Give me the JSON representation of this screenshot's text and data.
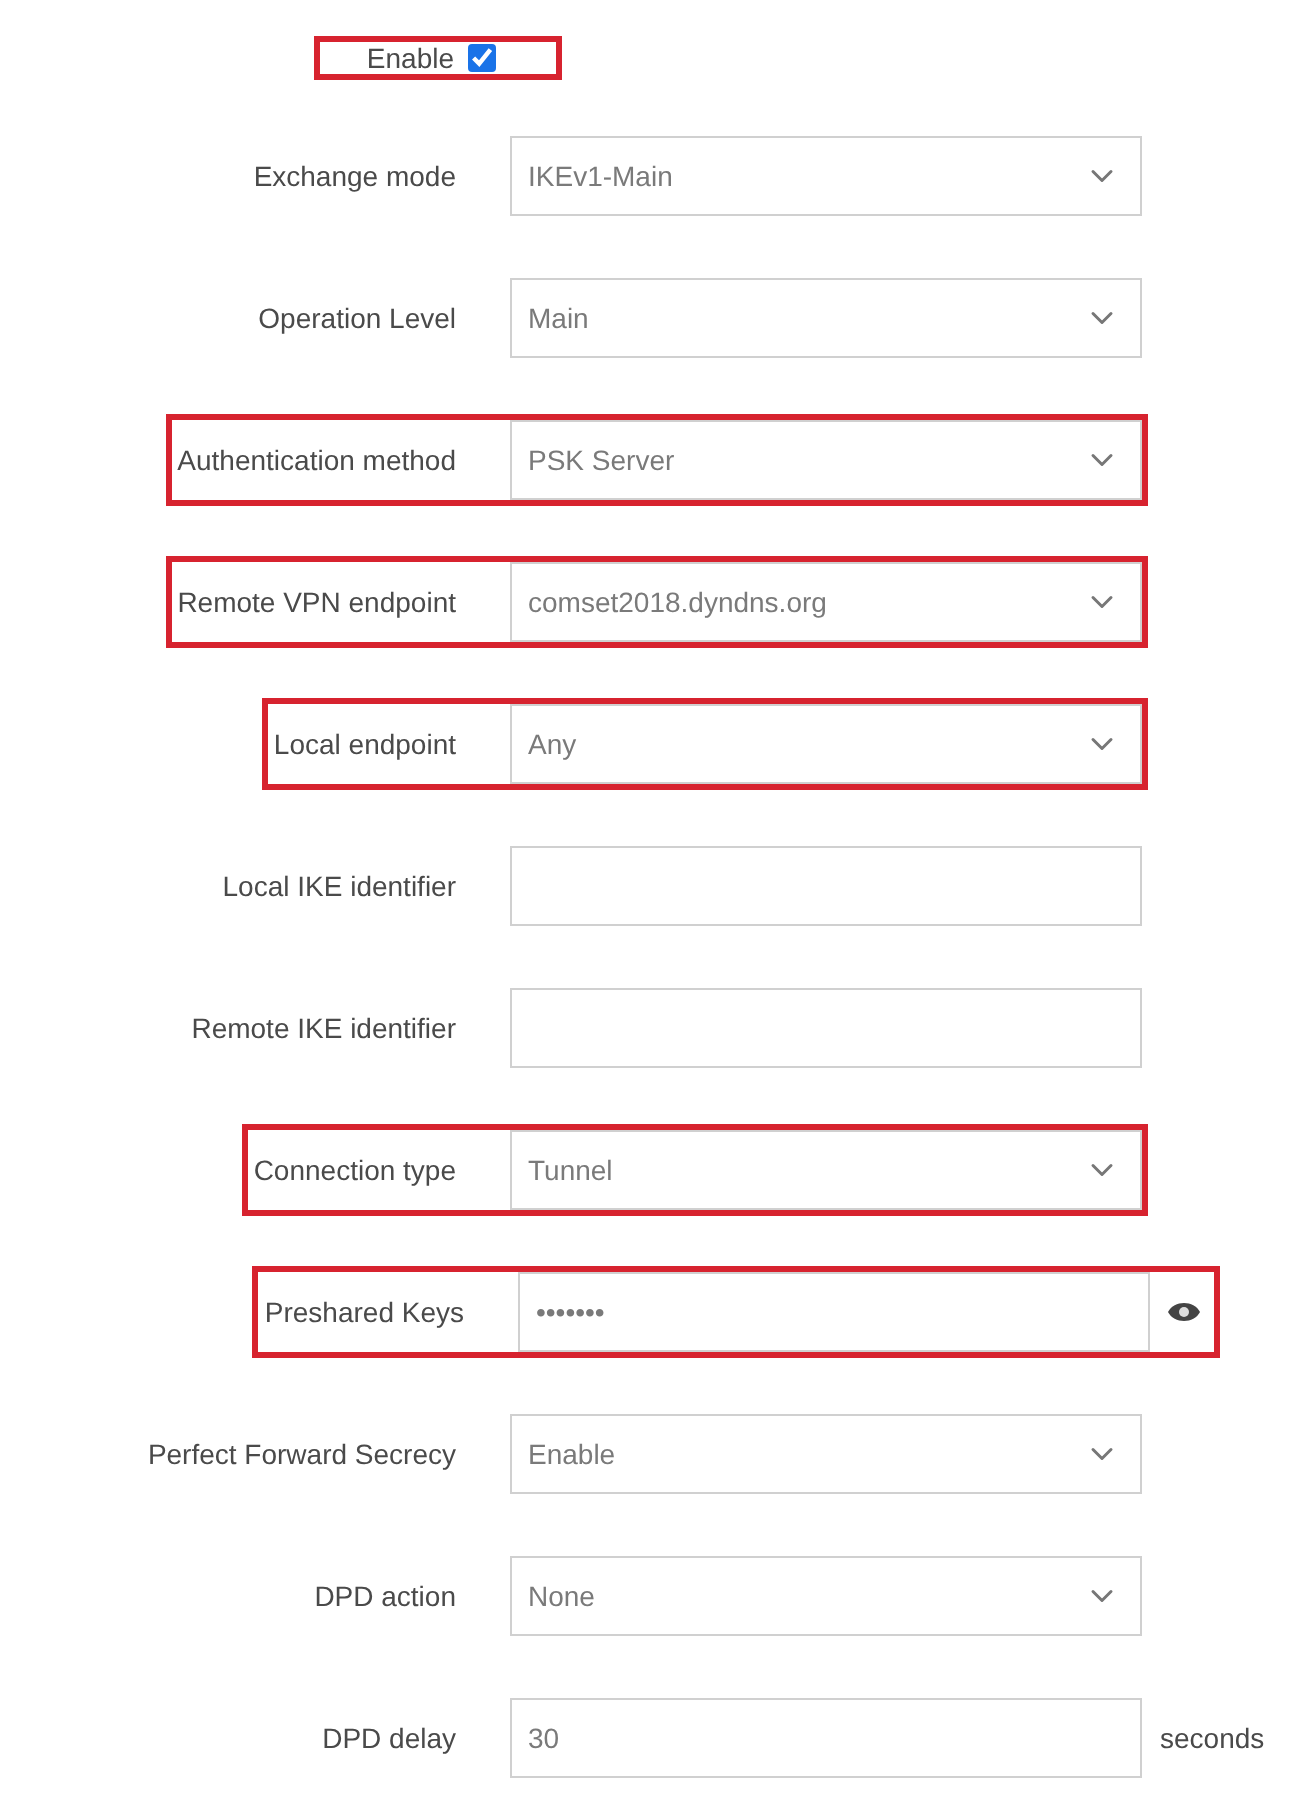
{
  "fields": [
    {
      "kind": "checkbox",
      "label": "Enable",
      "checked": true,
      "highlighted": true
    },
    {
      "kind": "select",
      "label": "Exchange mode",
      "value": "IKEv1-Main",
      "highlighted": false
    },
    {
      "kind": "select",
      "label": "Operation Level",
      "value": "Main",
      "highlighted": false
    },
    {
      "kind": "select",
      "label": "Authentication method",
      "value": "PSK Server",
      "highlighted": true
    },
    {
      "kind": "select",
      "label": "Remote VPN endpoint",
      "value": "comset2018.dyndns.org",
      "highlighted": true
    },
    {
      "kind": "select",
      "label": "Local endpoint",
      "value": "Any",
      "highlighted": true
    },
    {
      "kind": "text",
      "label": "Local IKE identifier",
      "highlighted": false
    },
    {
      "kind": "text",
      "label": "Remote IKE identifier",
      "highlighted": false
    },
    {
      "kind": "select",
      "label": "Connection type",
      "value": "Tunnel",
      "highlighted": true
    },
    {
      "kind": "password",
      "label": "Preshared Keys",
      "value": "•••••••",
      "highlighted": true
    },
    {
      "kind": "select",
      "label": "Perfect Forward Secrecy",
      "value": "Enable",
      "highlighted": false
    },
    {
      "kind": "select",
      "label": "DPD action",
      "value": "None",
      "highlighted": false
    },
    {
      "kind": "text",
      "label": "DPD delay",
      "value": "30",
      "suffix": "seconds",
      "highlighted": false
    }
  ]
}
